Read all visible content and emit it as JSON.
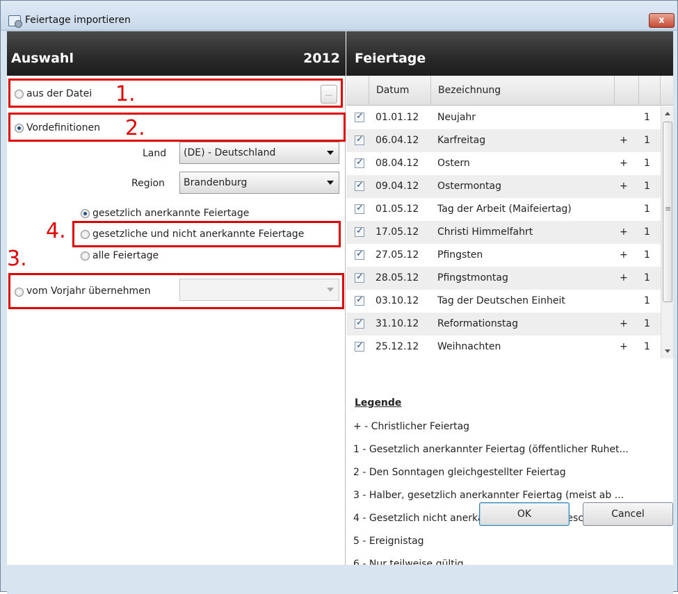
{
  "window": {
    "title": "Feiertage importieren",
    "close_label": "x"
  },
  "left": {
    "header_title": "Auswahl",
    "header_year": "2012",
    "file_option": {
      "label": "aus der Datei",
      "browse_label": "..."
    },
    "predef_option": {
      "label": "Vordefinitionen"
    },
    "land": {
      "label": "Land",
      "value": "(DE) - Deutschland"
    },
    "region": {
      "label": "Region",
      "value": "Brandenburg"
    },
    "sub_options": [
      "gesetzlich anerkannte Feiertage",
      "gesetzliche und nicht anerkannte Feiertage",
      "alle Feiertage"
    ],
    "prev_year_option": {
      "label": "vom Vorjahr übernehmen",
      "value": ""
    }
  },
  "annotations": {
    "n1": "1.",
    "n2": "2.",
    "n3": "3.",
    "n4": "4."
  },
  "right": {
    "header_title": "Feiertage",
    "columns": {
      "date": "Datum",
      "name": "Bezeichnung"
    },
    "rows": [
      {
        "date": "01.01.12",
        "name": "Neujahr",
        "christian": "",
        "type": "1"
      },
      {
        "date": "06.04.12",
        "name": "Karfreitag",
        "christian": "+",
        "type": "1"
      },
      {
        "date": "08.04.12",
        "name": "Ostern",
        "christian": "+",
        "type": "1"
      },
      {
        "date": "09.04.12",
        "name": "Ostermontag",
        "christian": "+",
        "type": "1"
      },
      {
        "date": "01.05.12",
        "name": "Tag der Arbeit (Maifeiertag)",
        "christian": "",
        "type": "1"
      },
      {
        "date": "17.05.12",
        "name": "Christi Himmelfahrt",
        "christian": "+",
        "type": "1"
      },
      {
        "date": "27.05.12",
        "name": "Pfingsten",
        "christian": "+",
        "type": "1"
      },
      {
        "date": "28.05.12",
        "name": "Pfingstmontag",
        "christian": "+",
        "type": "1"
      },
      {
        "date": "03.10.12",
        "name": "Tag der Deutschen Einheit",
        "christian": "",
        "type": "1"
      },
      {
        "date": "31.10.12",
        "name": "Reformationstag",
        "christian": "+",
        "type": "1"
      },
      {
        "date": "25.12.12",
        "name": "Weihnachten",
        "christian": "+",
        "type": "1"
      }
    ],
    "legend_title": "Legende",
    "legend": [
      "+ - Christlicher Feiertag",
      "1 - Gesetzlich anerkannter Feiertag (öffentlicher Ruhet...",
      "2 - Den Sonntagen gleichgestellter Feiertag",
      "3 - Halber, gesetzlich anerkannter Feiertag (meist ab ...",
      "4 - Gesetzlich nicht anerkannter Feiertag (Geschäfte, S...",
      "5 - Ereignistag",
      "6 - Nur teilweise gültig"
    ]
  },
  "buttons": {
    "ok": "OK",
    "cancel": "Cancel"
  }
}
